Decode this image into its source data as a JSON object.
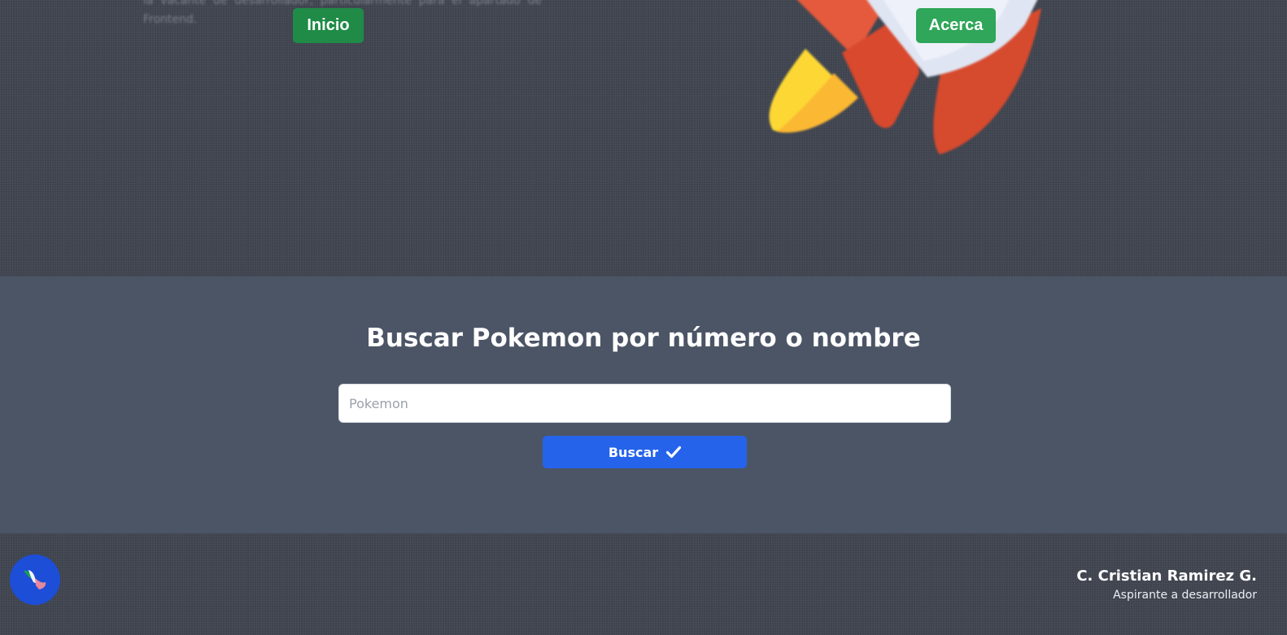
{
  "hero": {
    "blurred_text": "la vacante de desarrollador, particularmente para el apartado de Frontend.",
    "nav": {
      "inicio_label": "Inicio",
      "acerca_label": "Acerca"
    },
    "illustration": "rocket-illustration"
  },
  "search": {
    "title": "Buscar Pokemon por número o nombre",
    "input_placeholder": "Pokemon",
    "input_value": "",
    "button_label": "Buscar",
    "button_icon": "check-icon"
  },
  "footer": {
    "logo_icon": "mexico-map-icon",
    "author_name": "C. Cristian Ramirez G.",
    "author_role": "Aspirante a desarrollador"
  },
  "colors": {
    "hero_bg": "#414652",
    "search_bg": "#4c5566",
    "inicio_button": "#1f8b47",
    "acerca_button": "#2fa659",
    "search_button": "#2563eb",
    "logo_circle": "#1d4ed8"
  }
}
